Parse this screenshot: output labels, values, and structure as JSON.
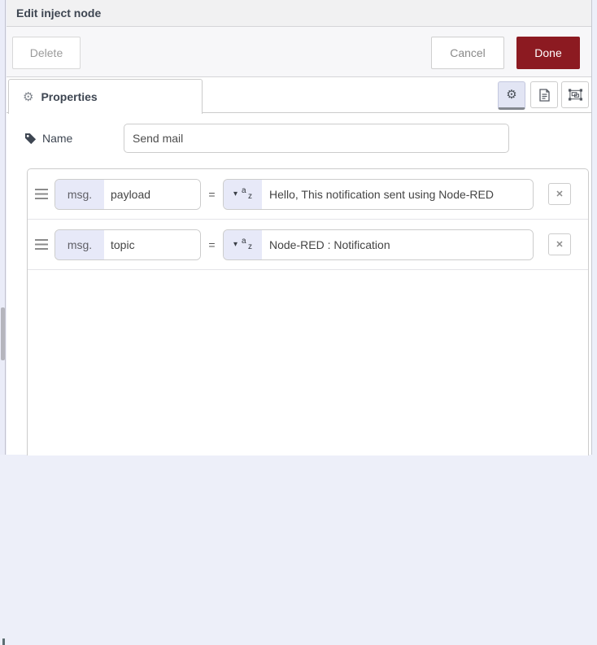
{
  "dialog": {
    "title": "Edit inject node"
  },
  "toolbar": {
    "delete_label": "Delete",
    "cancel_label": "Cancel",
    "done_label": "Done"
  },
  "tabs": {
    "properties_label": "Properties"
  },
  "name_field": {
    "label": "Name",
    "value": "Send mail"
  },
  "properties": {
    "rows": [
      {
        "prefix": "msg.",
        "key": "payload",
        "operator": "=",
        "type": "string",
        "value": "Hello, This notification sent using Node-RED"
      },
      {
        "prefix": "msg.",
        "key": "topic",
        "operator": "=",
        "type": "string",
        "value": "Node-RED : Notification"
      }
    ]
  },
  "glyphs": {
    "caret": "▾",
    "close": "✕",
    "gear": "⚙",
    "type_a": "a",
    "type_z": "z"
  },
  "colors": {
    "done_red": "#8C1A21",
    "lavender": "#e7e9f8",
    "active_tab_bg": "#e2e5f4"
  }
}
